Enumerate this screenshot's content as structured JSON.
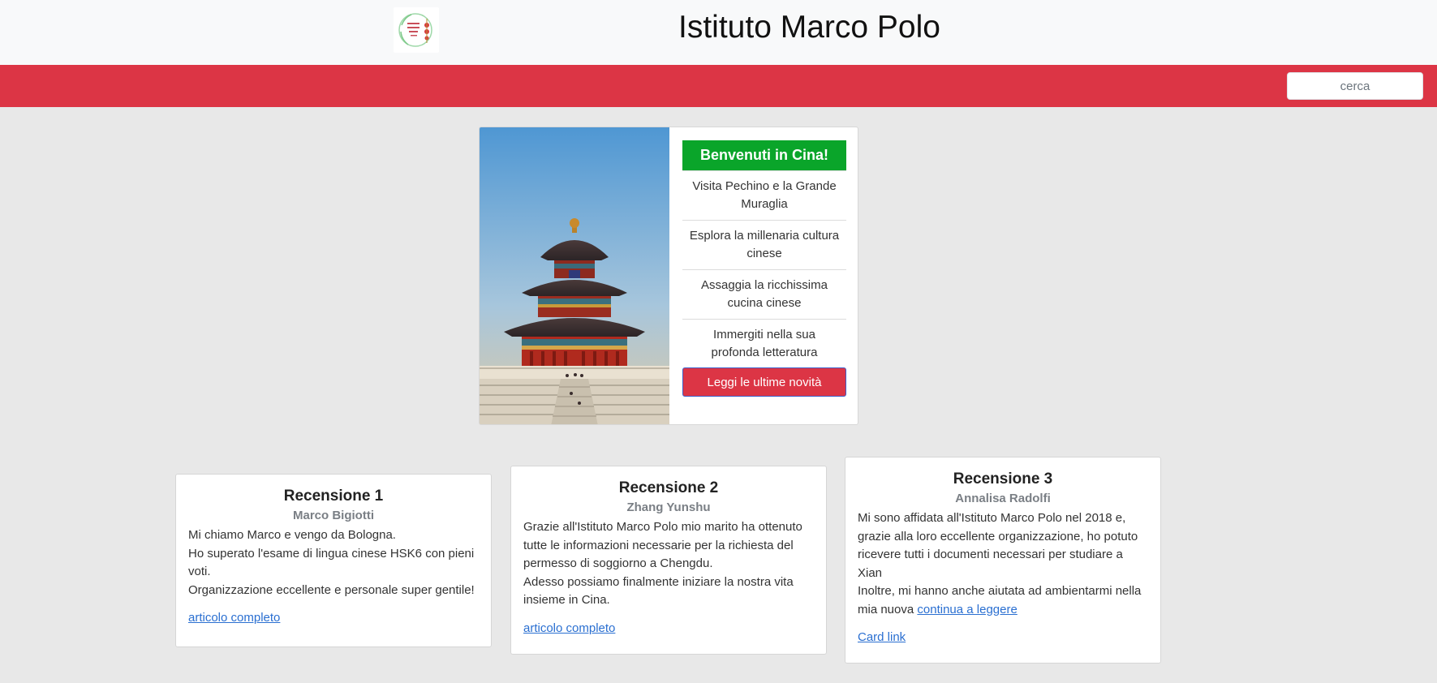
{
  "header": {
    "title": "Istituto Marco Polo"
  },
  "search": {
    "placeholder": "cerca"
  },
  "hero": {
    "welcome": "Benvenuti in Cina!",
    "items": [
      "Visita Pechino e la Grande Muraglia",
      "Esplora la millenaria cultura cinese",
      "Assaggia la ricchissima cucina cinese",
      "Immergiti nella sua profonda letteratura"
    ],
    "button_label": "Leggi le ultime novità"
  },
  "reviews": [
    {
      "title": "Recensione 1",
      "author": "Marco Bigiotti",
      "lines": [
        "Mi chiamo Marco e vengo da Bologna.",
        "Ho superato l'esame di lingua cinese HSK6 con pieni voti.",
        "Organizzazione eccellente e personale super gentile!"
      ],
      "link": "articolo completo"
    },
    {
      "title": "Recensione 2",
      "author": "Zhang Yunshu",
      "lines": [
        "Grazie all'Istituto Marco Polo mio marito ha ottenuto tutte le informazioni necessarie per la richiesta del permesso di soggiorno a Chengdu.",
        "Adesso possiamo finalmente iniziare la nostra vita insieme in Cina."
      ],
      "link": "articolo completo"
    },
    {
      "title": "Recensione 3",
      "author": "Annalisa Radolfi",
      "lines": [
        "Mi sono affidata all'Istituto Marco Polo nel 2018 e, grazie alla loro eccellente organizzazione, ho potuto ricevere tutti i documenti necessari per studiare a Xian"
      ],
      "last_line": "Inoltre, mi hanno anche aiutata ad ambientarmi nella mia nuova",
      "inline_link": "continua a leggere",
      "link": "Card link"
    }
  ],
  "colors": {
    "red": "#dc3545",
    "green": "#0aa52a",
    "link": "#2a6fd1"
  }
}
